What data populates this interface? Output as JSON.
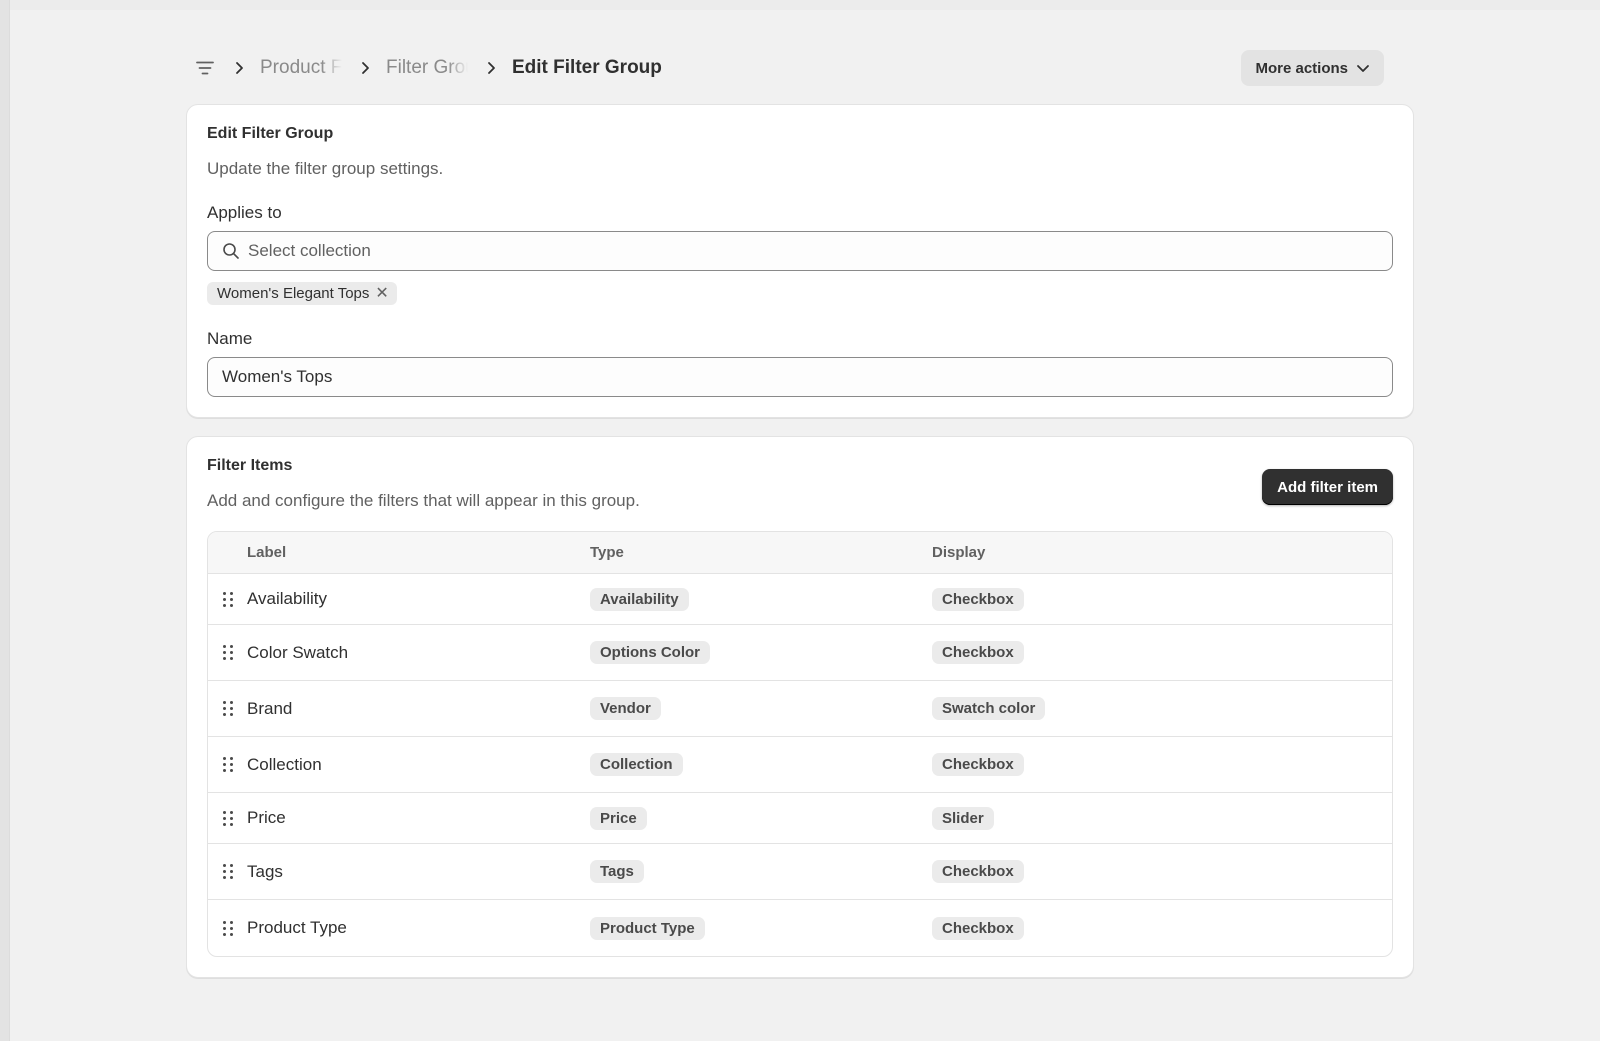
{
  "breadcrumb": {
    "items": [
      "Product Filters",
      "Filter Groups"
    ],
    "current": "Edit Filter Group"
  },
  "header": {
    "more_actions_label": "More actions"
  },
  "edit_card": {
    "title": "Edit Filter Group",
    "description": "Update the filter group settings.",
    "applies_to_label": "Applies to",
    "collection_placeholder": "Select collection",
    "selected_tag": "Women's Elegant Tops",
    "name_label": "Name",
    "name_value": "Women's Tops"
  },
  "filter_items": {
    "title": "Filter Items",
    "description": "Add and configure the filters that will appear in this group.",
    "add_button_label": "Add filter item",
    "columns": [
      "Label",
      "Type",
      "Display"
    ],
    "rows": [
      {
        "label": "Availability",
        "type": "Availability",
        "display": "Checkbox"
      },
      {
        "label": "Color Swatch",
        "type": "Options Color",
        "display": "Checkbox"
      },
      {
        "label": "Brand",
        "type": "Vendor",
        "display": "Swatch color"
      },
      {
        "label": "Collection",
        "type": "Collection",
        "display": "Checkbox"
      },
      {
        "label": "Price",
        "type": "Price",
        "display": "Slider"
      },
      {
        "label": "Tags",
        "type": "Tags",
        "display": "Checkbox"
      },
      {
        "label": "Product Type",
        "type": "Product Type",
        "display": "Checkbox"
      }
    ]
  },
  "colors": {
    "primary_button": "#303030",
    "page_bg": "#f1f1f1",
    "badge_bg": "#ebebeb"
  }
}
